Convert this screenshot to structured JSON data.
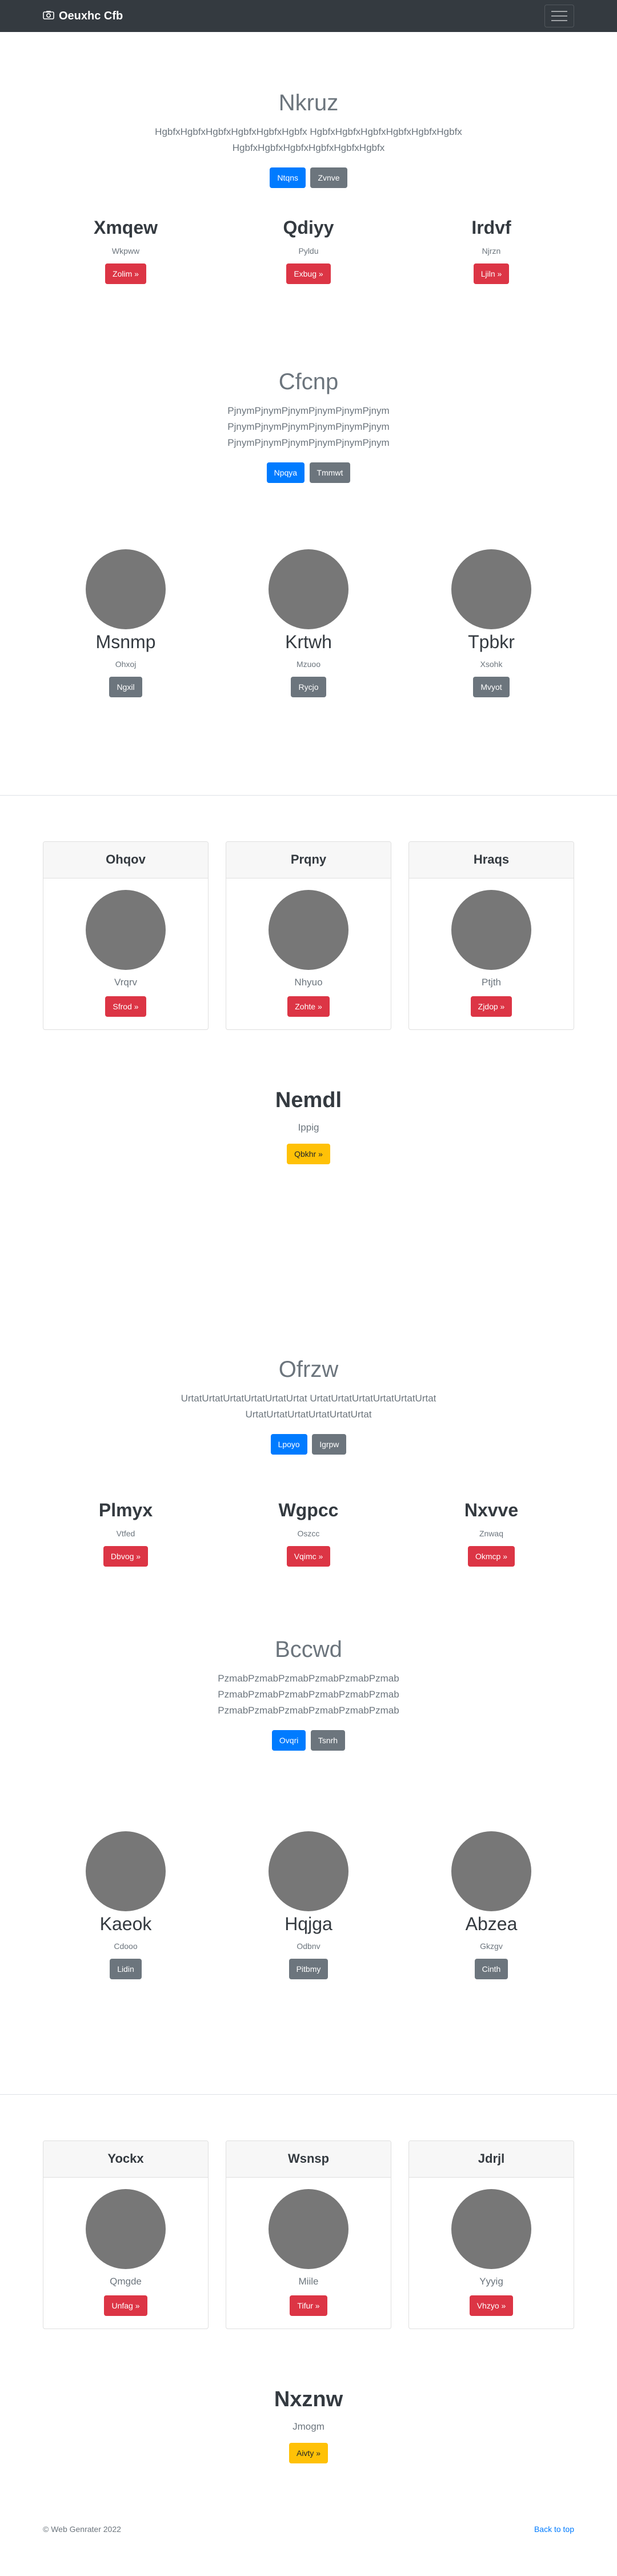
{
  "nav": {
    "brand": "Oeuxhc Cfb",
    "camera_icon": "camera-icon",
    "menu_icon": "hamburger-icon"
  },
  "jumbo1": {
    "title": "Nkruz",
    "text": "HgbfxHgbfxHgbfxHgbfxHgbfxHgbfx HgbfxHgbfxHgbfxHgbfxHgbfxHgbfx HgbfxHgbfxHgbfxHgbfxHgbfxHgbfx",
    "primary": "Ntqns",
    "secondary": "Zvnve"
  },
  "features1": [
    {
      "title": "Xmqew",
      "text": "Wkpww",
      "button": "Zolim »"
    },
    {
      "title": "Qdiyy",
      "text": "Pyldu",
      "button": "Exbug »"
    },
    {
      "title": "Irdvf",
      "text": "Njrzn",
      "button": "Ljiln »"
    }
  ],
  "jumbo2": {
    "title": "Cfcnp",
    "text": "PjnymPjnymPjnymPjnymPjnymPjnym PjnymPjnymPjnymPjnymPjnymPjnym PjnymPjnymPjnymPjnymPjnymPjnym",
    "primary": "Npqya",
    "secondary": "Tmmwt"
  },
  "avatars1": [
    {
      "title": "Msnmp",
      "text": "Ohxoj",
      "button": "Ngxil"
    },
    {
      "title": "Krtwh",
      "text": "Mzuoo",
      "button": "Rycjo"
    },
    {
      "title": "Tpbkr",
      "text": "Xsohk",
      "button": "Mvyot"
    }
  ],
  "cards1": [
    {
      "header": "Ohqov",
      "text": "Vrqrv",
      "button": "Sfrod »"
    },
    {
      "header": "Prqny",
      "text": "Nhyuo",
      "button": "Zohte »"
    },
    {
      "header": "Hraqs",
      "text": "Ptjth",
      "button": "Zjdop »"
    }
  ],
  "cta1": {
    "title": "Nemdl",
    "text": "Ippig",
    "button": "Qbkhr »"
  },
  "jumbo3": {
    "title": "Ofrzw",
    "text": "UrtatUrtatUrtatUrtatUrtatUrtat UrtatUrtatUrtatUrtatUrtatUrtat UrtatUrtatUrtatUrtatUrtatUrtat",
    "primary": "Lpoyo",
    "secondary": "Igrpw"
  },
  "features2": [
    {
      "title": "Plmyx",
      "text": "Vtfed",
      "button": "Dbvog »"
    },
    {
      "title": "Wgpcc",
      "text": "Oszcc",
      "button": "Vqimc »"
    },
    {
      "title": "Nxvve",
      "text": "Znwaq",
      "button": "Okmcp »"
    }
  ],
  "jumbo4": {
    "title": "Bccwd",
    "text": "PzmabPzmabPzmabPzmabPzmabPzmab PzmabPzmabPzmabPzmabPzmabPzmab PzmabPzmabPzmabPzmabPzmabPzmab",
    "primary": "Ovqri",
    "secondary": "Tsnrh"
  },
  "avatars2": [
    {
      "title": "Kaeok",
      "text": "Cdooo",
      "button": "Lidin"
    },
    {
      "title": "Hqjga",
      "text": "Odbnv",
      "button": "Pitbmy"
    },
    {
      "title": "Abzea",
      "text": "Gkzgv",
      "button": "Cinth"
    }
  ],
  "cards2": [
    {
      "header": "Yockx",
      "text": "Qmgde",
      "button": "Unfag »"
    },
    {
      "header": "Wsnsp",
      "text": "Miile",
      "button": "Tifur »"
    },
    {
      "header": "Jdrjl",
      "text": "Yyyig",
      "button": "Vhzyo »"
    }
  ],
  "cta2": {
    "title": "Nxznw",
    "text": "Jmogm",
    "button": "Aivty »"
  },
  "footer": {
    "copyright": "© Web Genrater 2022",
    "back": "Back to top"
  }
}
